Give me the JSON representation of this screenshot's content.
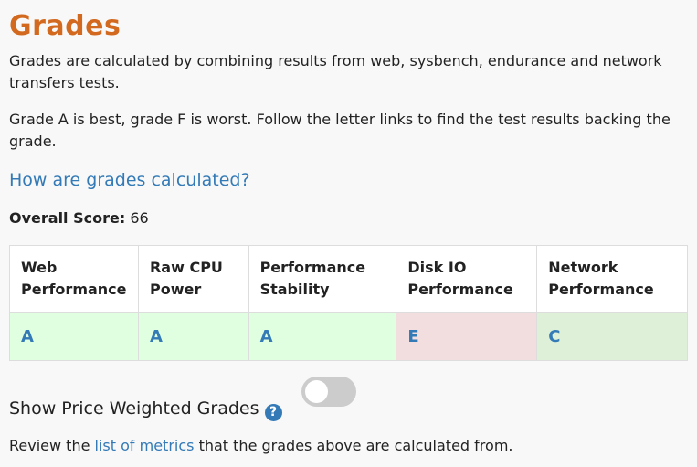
{
  "page": {
    "title": "Grades",
    "intro": "Grades are calculated by combining results from web, sysbench, endurance and network transfers tests.",
    "grade_explanation": "Grade A is best, grade F is worst. Follow the letter links to find the test results backing the grade.",
    "how_link": "How are grades calculated?",
    "overall_label": "Overall Score:",
    "overall_value": "66"
  },
  "table": {
    "headers": [
      "Web Performance",
      "Raw CPU Power",
      "Performance Stability",
      "Disk IO Performance",
      "Network Performance"
    ],
    "grades": [
      "A",
      "A",
      "A",
      "E",
      "C"
    ]
  },
  "price_toggle": {
    "label": "Show Price Weighted Grades",
    "checked": false
  },
  "review": {
    "prefix": "Review the",
    "link": "list of metrics",
    "suffix": "that the grades above are calculated from."
  },
  "colors": {
    "title": "#d2691e",
    "link": "#337ab7",
    "grade_good": "#e0ffe0",
    "grade_bad": "#f2dede",
    "grade_mid": "#dff0d8"
  }
}
